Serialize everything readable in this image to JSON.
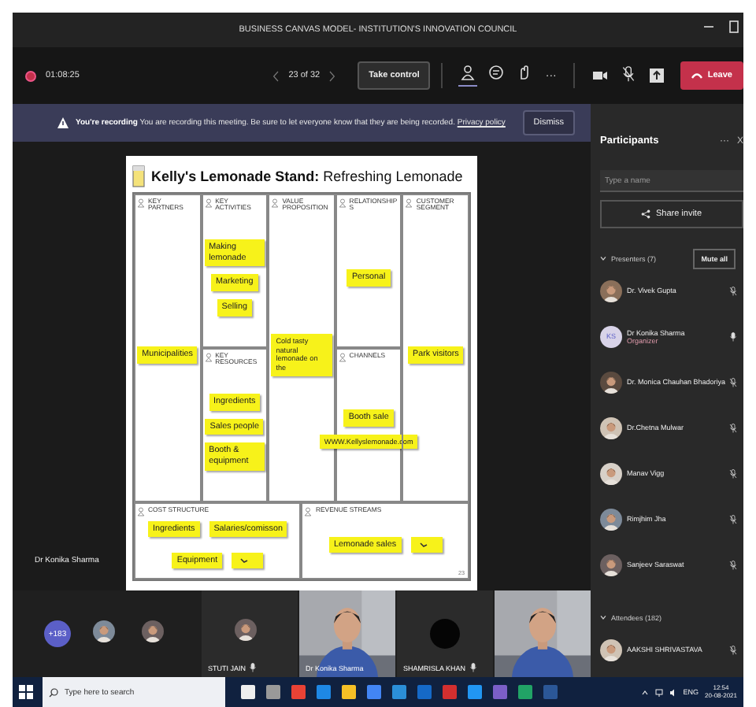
{
  "window": {
    "title": "BUSINESS CANVAS MODEL- INSTITUTION'S INNOVATION COUNCIL"
  },
  "toolbar": {
    "timer": "01:08:25",
    "page": "23 of 32",
    "take_control": "Take control",
    "more": "···",
    "leave": "Leave",
    "mic_muted": true,
    "tools": [
      {
        "kind": "people",
        "selected": true
      },
      {
        "kind": "chat",
        "selected": false
      },
      {
        "kind": "reactions",
        "selected": false
      }
    ]
  },
  "banner": {
    "heading": "You're recording",
    "message": "You are recording this meeting. Be sure to let everyone know that they are being recorded.",
    "link": "Privacy policy",
    "dismiss": "Dismiss"
  },
  "slide": {
    "title": "**Kelly's Lemonade Stand:** Refreshing Lemonade",
    "page_number": "23",
    "blocks": [
      {
        "label": "KEY PARTNERS",
        "notes": [
          {
            "text": "Municipalities"
          }
        ]
      },
      {
        "label": "KEY ACTIVITIES",
        "notes": [
          {
            "text": "Making lemonade"
          },
          {
            "text": "Marketing"
          },
          {
            "text": "Selling"
          }
        ]
      },
      {
        "label": "KEY RESOURCES",
        "notes": [
          {
            "text": "Ingredients"
          },
          {
            "text": "Sales people"
          },
          {
            "text": "Booth & equipment"
          }
        ]
      },
      {
        "label": "VALUE PROPOSITION",
        "notes": [
          {
            "text": "Cold tasty natural lemonade on the"
          }
        ]
      },
      {
        "label": "RELATIONSHIPS",
        "notes": [
          {
            "text": "Personal"
          }
        ]
      },
      {
        "label": "CHANNELS",
        "notes": [
          {
            "text": "Booth sale"
          },
          {
            "text": "WWW.Kellyslemonade.com"
          }
        ]
      },
      {
        "label": "CUSTOMER SEGMENT",
        "notes": [
          {
            "text": "Park visitors"
          }
        ]
      },
      {
        "label": "COST STRUCTURE",
        "notes": [
          {
            "text": "Ingredients"
          },
          {
            "text": "Salaries/comisson"
          },
          {
            "text": "Equipment"
          },
          {
            "kind": "scribble"
          }
        ]
      },
      {
        "label": "REVENUE STREAMS",
        "notes": [
          {
            "text": "Lemonade sales"
          },
          {
            "kind": "scribble"
          }
        ]
      }
    ]
  },
  "presenter_label": "Dr Konika Sharma",
  "gallery": {
    "overflow": "+183",
    "tiles": [
      {
        "kind": "avatar",
        "name": "STUTI JAIN"
      },
      {
        "kind": "video",
        "name": "Dr Konika Sharma"
      },
      {
        "kind": "dark",
        "name": "SHAMRISLA KHAN"
      },
      {
        "kind": "video"
      }
    ]
  },
  "participants": {
    "title": "Participants",
    "more": "···",
    "close": "X",
    "search": {
      "placeholder": "Type a name"
    },
    "share_invite": "Share invite",
    "groups": [
      {
        "label": "Presenters (7)",
        "expanded": true,
        "mute_all": "Mute all",
        "people": [
          {
            "name": "Dr. Vivek Gupta",
            "muted": true
          },
          {
            "name": "Dr Konika Sharma",
            "role": "Organizer",
            "initials": "KS",
            "muted": false
          },
          {
            "name": "Dr. Monica Chauhan Bhadoriya",
            "muted": true
          },
          {
            "name": "Dr.Chetna Mulwar",
            "muted": true
          },
          {
            "name": "Manav Vigg",
            "muted": true
          },
          {
            "name": "Rimjhim Jha",
            "muted": true
          },
          {
            "name": "Sanjeev Saraswat",
            "muted": true
          }
        ]
      },
      {
        "label": "Attendees (182)",
        "expanded": true,
        "people": [
          {
            "name": "AAKSHI SHRIVASTAVA",
            "muted": true
          }
        ]
      }
    ]
  },
  "taskbar": {
    "search": {
      "placeholder": "Type here to search"
    },
    "language": "ENG",
    "time": "12:54",
    "date": "20-08-2021"
  }
}
